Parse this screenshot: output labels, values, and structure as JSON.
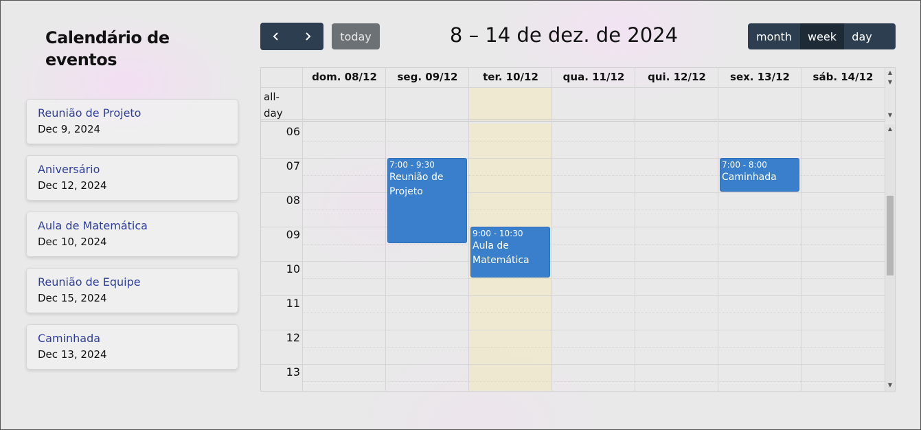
{
  "sidebar": {
    "title": "Calendário de eventos",
    "events": [
      {
        "name": "Reunião de Projeto",
        "date": "Dec 9, 2024"
      },
      {
        "name": "Aniversário",
        "date": "Dec 12, 2024"
      },
      {
        "name": "Aula de Matemática",
        "date": "Dec 10, 2024"
      },
      {
        "name": "Reunião de Equipe",
        "date": "Dec 15, 2024"
      },
      {
        "name": "Caminhada",
        "date": "Dec 13, 2024"
      }
    ]
  },
  "toolbar": {
    "prev_icon": "chevron-left-icon",
    "next_icon": "chevron-right-icon",
    "today_label": "today",
    "title": "8 – 14 de dez. de 2024",
    "views": [
      "month",
      "week",
      "day"
    ],
    "active_view": "week"
  },
  "calendar": {
    "allday_label": "all-day",
    "days": [
      "dom. 08/12",
      "seg. 09/12",
      "ter. 10/12",
      "qua. 11/12",
      "qui. 12/12",
      "sex. 13/12",
      "sáb. 14/12"
    ],
    "today_index": 2,
    "hours": [
      "06",
      "07",
      "08",
      "09",
      "10",
      "11",
      "12",
      "13"
    ],
    "events": [
      {
        "time": "7:00 - 9:30",
        "title": "Reunião de Projeto",
        "day": 1,
        "start": 7.0,
        "end": 9.5
      },
      {
        "time": "9:00 - 10:30",
        "title": "Aula de Matemática",
        "day": 2,
        "start": 9.0,
        "end": 10.5
      },
      {
        "time": "7:00 - 8:00",
        "title": "Caminhada",
        "day": 5,
        "start": 7.0,
        "end": 8.0
      }
    ]
  },
  "colors": {
    "event": "#3a7fcc",
    "button": "#2c3e50",
    "today_bg": "#f0e8c8",
    "sidebar_link": "#2e3d9a"
  }
}
